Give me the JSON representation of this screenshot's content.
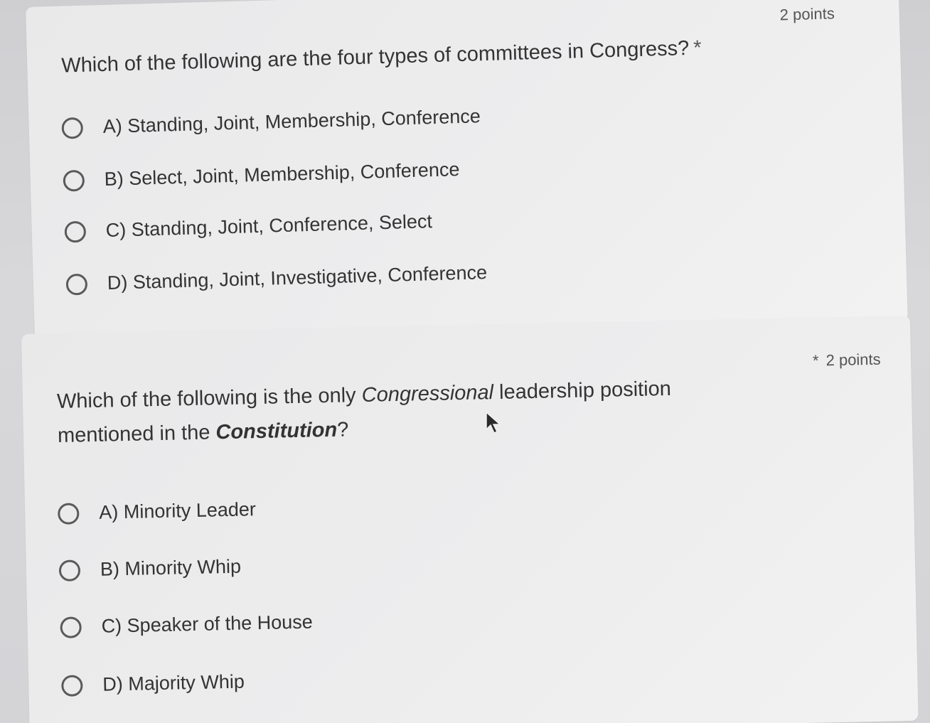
{
  "questions": [
    {
      "text": "Which of the following are the four types of committees in Congress?",
      "required_mark": "*",
      "points": "2 points",
      "options": [
        "A) Standing, Joint, Membership, Conference",
        "B) Select, Joint, Membership, Conference",
        "C) Standing, Joint, Conference, Select",
        "D) Standing, Joint, Investigative, Conference"
      ]
    },
    {
      "text_part1": "Which of the following is the only ",
      "text_emph1": "Congressional",
      "text_part2": " leadership position mentioned in the ",
      "text_emph2": "Constitution",
      "text_part3": "?",
      "required_mark": "*",
      "points": "2 points",
      "options": [
        "A) Minority Leader",
        "B) Minority Whip",
        "C) Speaker of the House",
        "D) Majority Whip"
      ]
    }
  ],
  "icons": {
    "cursor": "mouse-pointer-icon",
    "radio": "radio-button-unselected"
  }
}
